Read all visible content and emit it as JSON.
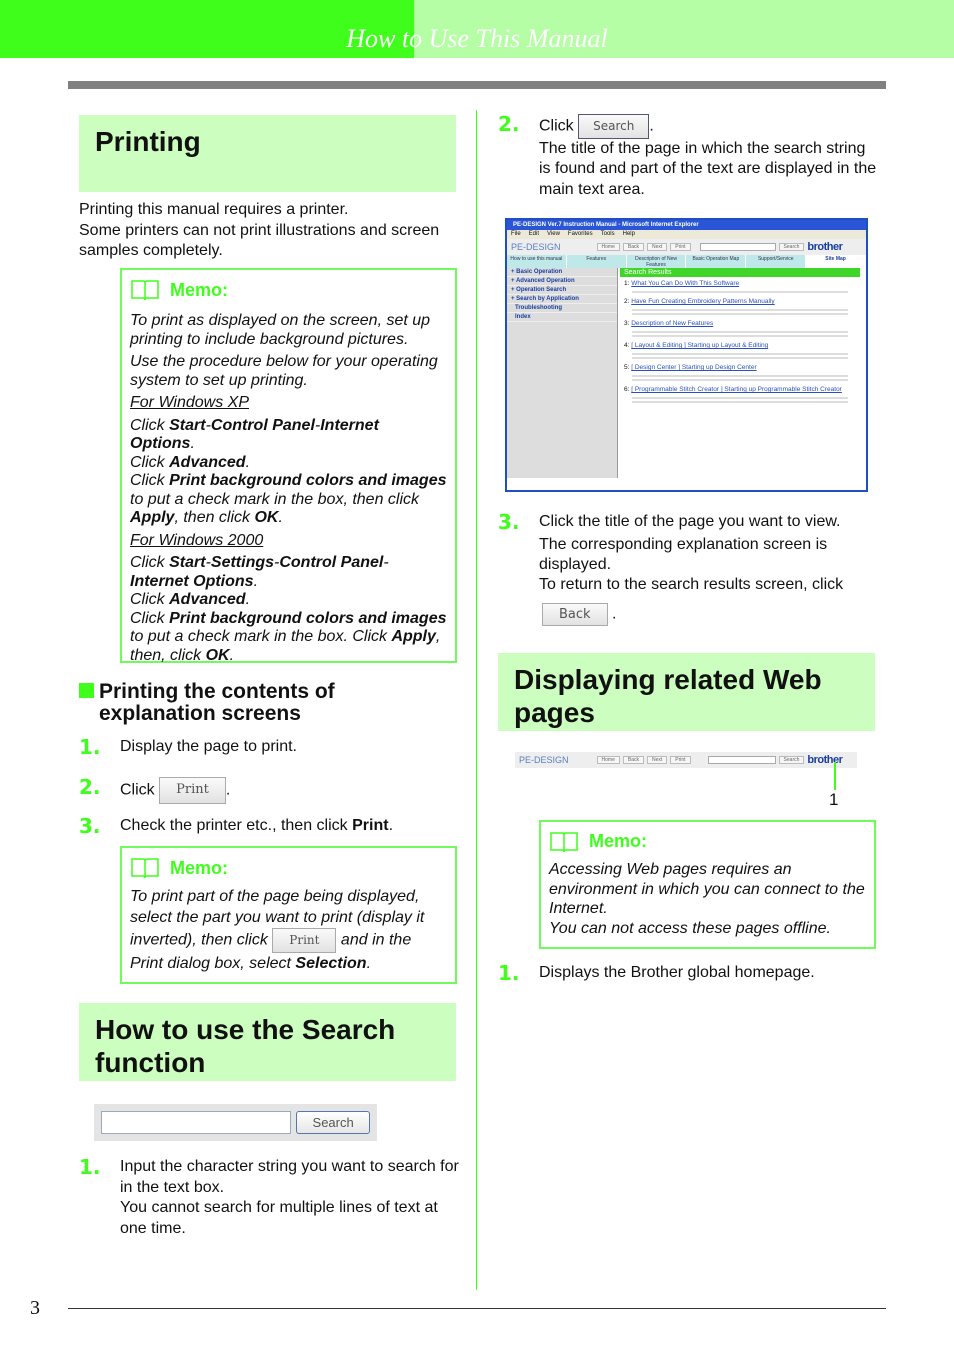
{
  "header": {
    "title": "How to Use This Manual"
  },
  "page_number": "3",
  "colors": {
    "accent": "#3ffe1c",
    "accent_light": "#b5fea6",
    "heading_bg": "#ccfec0"
  },
  "printing": {
    "title": "Printing",
    "intro": [
      "Printing this manual requires a printer.",
      "Some printers can not print illustrations and screen samples completely."
    ],
    "memo": {
      "label": "Memo:",
      "p1": "To print as displayed on the screen, set up printing to include background pictures.",
      "p2": "Use the procedure below for your operating system to set up printing.",
      "xp_head": "For Windows XP",
      "xp_1a": "Click ",
      "xp_1b": "Start",
      "xp_1c": "-",
      "xp_1d": "Control Panel",
      "xp_1e": "-",
      "xp_1f": "Internet Options",
      "xp_1g": ".",
      "xp_2a": "Click ",
      "xp_2b": "Advanced",
      "xp_2c": ".",
      "xp_3a": "Click ",
      "xp_3b": "Print background colors and images",
      "xp_3c": " to put a check mark in the box, then click ",
      "xp_3d": "Apply",
      "xp_3e": ", then click ",
      "xp_3f": "OK",
      "xp_3g": ".",
      "w2k_head": "For Windows 2000",
      "w2k_1a": "Click ",
      "w2k_1b": "Start",
      "w2k_1c": "-",
      "w2k_1d": "Settings",
      "w2k_1e": "-",
      "w2k_1f": "Control Panel",
      "w2k_1g": "-",
      "w2k_1h": "Internet Options",
      "w2k_1i": ".",
      "w2k_2a": "Click ",
      "w2k_2b": "Advanced",
      "w2k_2c": ".",
      "w2k_3a": "Click ",
      "w2k_3b": "Print background colors and images",
      "w2k_3c": " to put a check mark in the box. Click ",
      "w2k_3d": "Apply",
      "w2k_3e": ", then, click ",
      "w2k_3f": "OK",
      "w2k_3g": "."
    }
  },
  "print_contents": {
    "title_1": "Printing the contents of",
    "title_2": "explanation screens",
    "steps": [
      {
        "num": "1.",
        "text": "Display the page to print."
      },
      {
        "num": "2.",
        "text": "Click ",
        "button": "Print",
        "after": "."
      },
      {
        "num": "3.",
        "text": "Check the printer etc., then click ",
        "bold": "Print",
        "after": "."
      }
    ],
    "memo": {
      "label": "Memo:",
      "a": "To print part of the page being displayed, select the part you want to print (display it inverted), then click ",
      "button": "Print",
      "b": " and in the Print dialog box, select ",
      "c": "Selection",
      "d": "."
    }
  },
  "search": {
    "title": "How to use the Search function",
    "input_value": "",
    "button": "Search",
    "steps": [
      {
        "num": "1.",
        "text": "Input the character string you want to search for in the text box.",
        "text2": "You cannot search for multiple lines of text at one time."
      },
      {
        "num": "2.",
        "text": "Click ",
        "button": "Search",
        "after": ".",
        "text2": "The title of the page in which the search string is found and part of the text are displayed in the main text area."
      },
      {
        "num": "3.",
        "text": "Click the title of the page you want to view.",
        "text2": "The corresponding explanation screen is displayed.",
        "text3": "To return to the search results screen, click",
        "button": "Back",
        "after": "."
      }
    ]
  },
  "browser": {
    "title": "PE-DESIGN Ver.7 Instruction Manual - Microsoft Internet Explorer",
    "menu": [
      "File",
      "Edit",
      "View",
      "Favorites",
      "Tools",
      "Help"
    ],
    "logo": "PE-DESIGN",
    "buttons": [
      "Home",
      "Back",
      "Next",
      "Print"
    ],
    "search_button": "Search",
    "brand": "brother",
    "tabs": [
      "How to use this manual",
      "Features",
      "Description of New Features",
      "Basic Operation Map",
      "Support/Service",
      "Site Map"
    ],
    "sidebar": [
      "+ Basic Operation",
      "+ Advanced Operation",
      "+ Operation Search",
      "+ Search by Application",
      "Troubleshooting",
      "Index"
    ],
    "results_header": "Search Results",
    "results": [
      {
        "n": "1:",
        "t": "What You Can Do With This Software"
      },
      {
        "n": "2:",
        "t": "Have Fun Creating Embroidery Patterns Manually"
      },
      {
        "n": "3:",
        "t": "Description of New Features"
      },
      {
        "n": "4:",
        "t": "[ Layout & Editing ] Starting up Layout & Editing"
      },
      {
        "n": "5:",
        "t": "[ Design Center ] Starting up Design Center"
      },
      {
        "n": "6:",
        "t": "[ Programmable Stitch Creator ] Starting up Programmable Stitch Creator"
      }
    ]
  },
  "related": {
    "title": "Displaying related Web pages",
    "callout": "1",
    "memo": {
      "label": "Memo:",
      "p1": "Accessing Web pages requires an environment in which you can connect to the Internet.",
      "p2": "You can not access these pages offline."
    },
    "steps": [
      {
        "num": "1.",
        "text": "Displays the Brother global homepage."
      }
    ]
  }
}
